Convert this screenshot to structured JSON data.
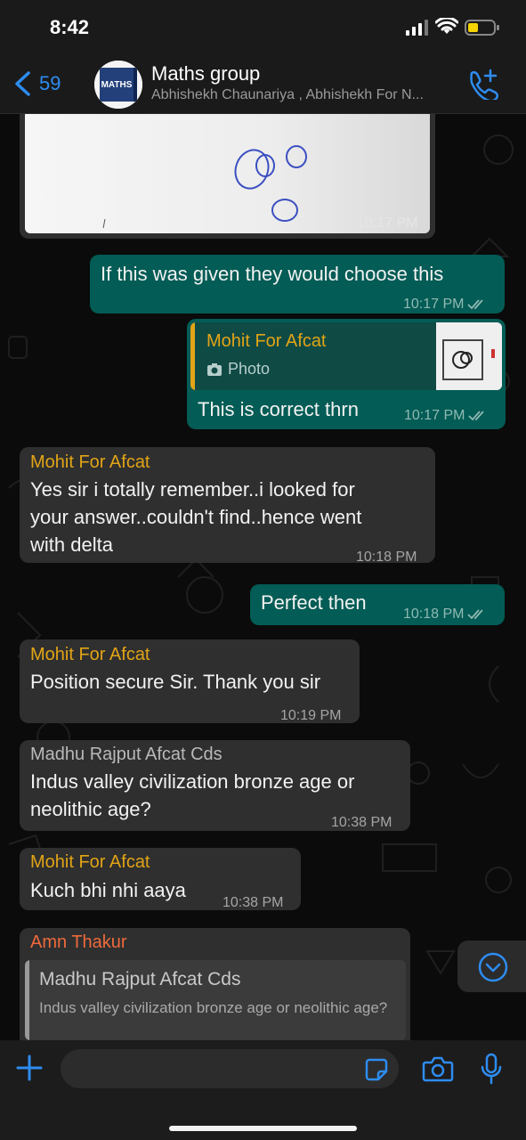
{
  "status_bar": {
    "time": "8:42"
  },
  "header": {
    "back_count": "59",
    "title": "Maths group",
    "members": "Abhishekh Chaunariya , Abhishekh For N...",
    "avatar_text": "MATHS"
  },
  "messages": [
    {
      "type": "image",
      "time": "10:17 PM"
    },
    {
      "type": "out",
      "text": "If this was given they would choose this",
      "time": "10:17 PM"
    },
    {
      "type": "out_reply",
      "quote_author": "Mohit For Afcat",
      "quote_label": "Photo",
      "text": "This is correct thrn",
      "time": "10:17 PM"
    },
    {
      "type": "in",
      "sender": "Mohit For Afcat",
      "lines": [
        "Yes sir i totally remember..i looked for",
        "your answer..couldn't find..hence went",
        "with delta"
      ],
      "time": "10:18 PM"
    },
    {
      "type": "out",
      "text": "Perfect then",
      "time": "10:18 PM"
    },
    {
      "type": "in",
      "sender": "Mohit For Afcat",
      "text": "Position secure Sir. Thank you sir",
      "time": "10:19 PM"
    },
    {
      "type": "in",
      "sender": "Madhu Rajput Afcat Cds",
      "lines": [
        "Indus valley civilization bronze age or",
        "neolithic age?"
      ],
      "time": "10:38 PM"
    },
    {
      "type": "in",
      "sender": "Mohit For Afcat",
      "text": "Kuch bhi nhi aaya",
      "time": "10:38 PM"
    },
    {
      "type": "in_reply",
      "sender": "Amn Thakur",
      "quote_author": "Madhu Rajput Afcat Cds",
      "quote_text": "Indus valley civilization bronze age or neolithic age?"
    }
  ],
  "input": {
    "placeholder": ""
  },
  "colors": {
    "outgoing": "#035c55",
    "incoming": "#2f2f2f",
    "accent": "#2e8cf0",
    "mohit": "#e2a416",
    "amn": "#ee6a3c"
  },
  "icons": [
    "back-chevron-icon",
    "call-add-icon",
    "camera-icon",
    "plus-icon",
    "sticker-icon",
    "mic-icon",
    "scroll-down-icon",
    "double-check-icon"
  ]
}
